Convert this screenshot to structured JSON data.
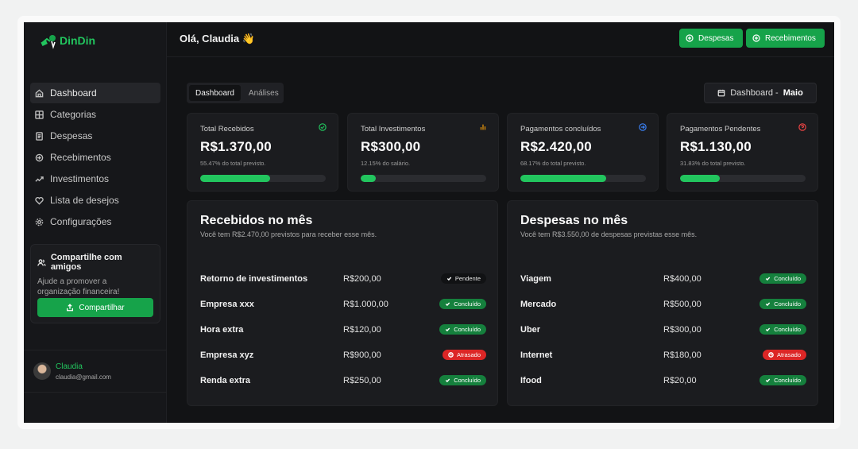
{
  "brand": {
    "name": "DinDin",
    "accent": "#22c55e"
  },
  "header": {
    "greeting": "Olá, Claudia 👋",
    "btn_despesas": "Despesas",
    "btn_recebimentos": "Recebimentos"
  },
  "sidebar": {
    "items": [
      {
        "label": "Dashboard",
        "icon": "home-icon"
      },
      {
        "label": "Categorias",
        "icon": "grid-icon"
      },
      {
        "label": "Despesas",
        "icon": "receipt-icon"
      },
      {
        "label": "Recebimentos",
        "icon": "incoming-icon"
      },
      {
        "label": "Investimentos",
        "icon": "trend-icon"
      },
      {
        "label": "Lista de desejos",
        "icon": "heart-icon"
      },
      {
        "label": "Configurações",
        "icon": "settings-icon"
      }
    ],
    "share": {
      "title": "Compartilhe com amigos",
      "desc": "Ajude a promover a organização financeira!",
      "button": "Compartilhar"
    },
    "user": {
      "name": "Claudia",
      "email": "claudia@gmail.com"
    }
  },
  "tabs": [
    "Dashboard",
    "Análises"
  ],
  "period": {
    "label": "Dashboard -",
    "month": "Maio"
  },
  "stats": [
    {
      "label": "Total Recebidos",
      "value": "R$1.370,00",
      "sub": "55.47% do total previsto.",
      "progress": 0.5547,
      "icon": "check-circle-icon",
      "icon_color": "#22c55e"
    },
    {
      "label": "Total Investimentos",
      "value": "R$300,00",
      "sub": "12.15% do salário.",
      "progress": 0.1215,
      "icon": "bar-chart-icon",
      "icon_color": "#f59e0b"
    },
    {
      "label": "Pagamentos concluídos",
      "value": "R$2.420,00",
      "sub": "68.17% do total previsto.",
      "progress": 0.6817,
      "icon": "arrow-right-circle-icon",
      "icon_color": "#3b82f6"
    },
    {
      "label": "Pagamentos Pendentes",
      "value": "R$1.130,00",
      "sub": "31.83% do total previsto.",
      "progress": 0.3183,
      "icon": "help-circle-icon",
      "icon_color": "#ef4444"
    }
  ],
  "recebidos": {
    "title": "Recebidos no mês",
    "subtitle": "Você tem R$2.470,00 previstos para receber esse mês.",
    "rows": [
      {
        "name": "Retorno de investimentos",
        "amount": "R$200,00",
        "status": "Pendente",
        "kind": "pend"
      },
      {
        "name": "Empresa xxx",
        "amount": "R$1.000,00",
        "status": "Concluído",
        "kind": "done"
      },
      {
        "name": "Hora extra",
        "amount": "R$120,00",
        "status": "Concluído",
        "kind": "done"
      },
      {
        "name": "Empresa xyz",
        "amount": "R$900,00",
        "status": "Atrasado",
        "kind": "late"
      },
      {
        "name": "Renda extra",
        "amount": "R$250,00",
        "status": "Concluído",
        "kind": "done"
      }
    ]
  },
  "despesas": {
    "title": "Despesas no mês",
    "subtitle": "Você tem R$3.550,00 de despesas previstas esse mês.",
    "rows": [
      {
        "name": "Viagem",
        "amount": "R$400,00",
        "status": "Concluído",
        "kind": "done"
      },
      {
        "name": "Mercado",
        "amount": "R$500,00",
        "status": "Concluído",
        "kind": "done"
      },
      {
        "name": "Uber",
        "amount": "R$300,00",
        "status": "Concluído",
        "kind": "done"
      },
      {
        "name": "Internet",
        "amount": "R$180,00",
        "status": "Atrasado",
        "kind": "late"
      },
      {
        "name": "Ifood",
        "amount": "R$20,00",
        "status": "Concluído",
        "kind": "done"
      }
    ]
  }
}
